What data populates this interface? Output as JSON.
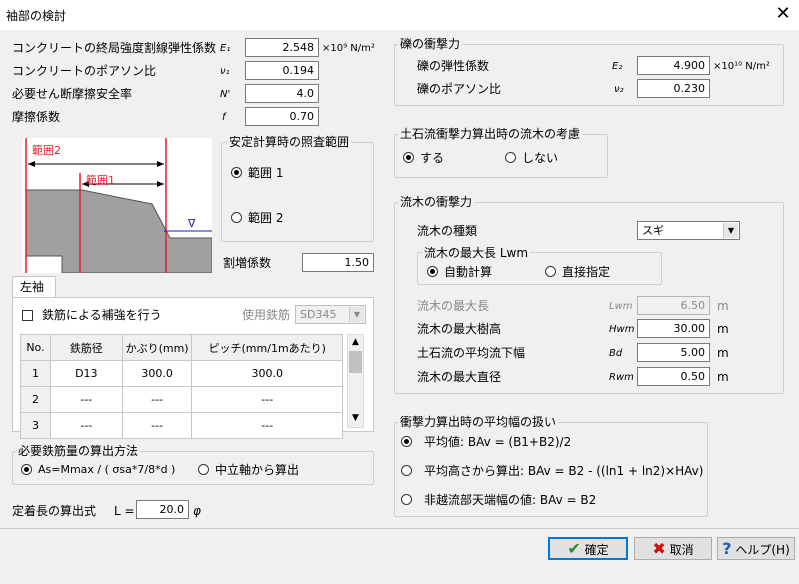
{
  "window": {
    "title": "袖部の検討",
    "close": "✕"
  },
  "left": {
    "fields": [
      {
        "label": "コンクリートの終局強度割線弾性係数",
        "symbol": "E₁",
        "value": "2.548",
        "unit": "×10⁹  N/m²"
      },
      {
        "label": "コンクリートのポアソン比",
        "symbol": "ν₁",
        "value": "0.194",
        "unit": ""
      },
      {
        "label": "必要せん断摩擦安全率",
        "symbol": "N'",
        "value": "4.0",
        "unit": ""
      },
      {
        "label": "摩擦係数",
        "symbol": "f",
        "value": "0.70",
        "unit": ""
      }
    ],
    "figure": {
      "range2": "範囲2",
      "range1": "範囲1",
      "water": "∇"
    },
    "range_group": {
      "title": "安定計算時の照査範囲",
      "options": [
        "範囲 1",
        "範囲 2"
      ],
      "selected": 0
    },
    "extra": {
      "label": "割増係数",
      "value": "1.50"
    },
    "tab": "左袖",
    "rebar": {
      "check_label": "鉄筋による補強を行う",
      "checked": false,
      "steel_label": "使用鉄筋",
      "steel_value": "SD345",
      "columns": [
        "No.",
        "鉄筋径",
        "かぶり(mm)",
        "ピッチ(mm/1mあたり)"
      ],
      "rows": [
        [
          "1",
          "D13",
          "300.0",
          "300.0"
        ],
        [
          "2",
          "---",
          "---",
          "---"
        ],
        [
          "3",
          "---",
          "---",
          "---"
        ]
      ]
    },
    "method": {
      "title": "必要鉄筋量の算出方法",
      "options": [
        "As=Mmax / ( σsa*7/8*d )",
        "中立軸から算出"
      ],
      "selected": 0
    },
    "anchor": {
      "label": "定着長の算出式",
      "prefix": "L =",
      "value": "20.0",
      "suffix": "φ"
    }
  },
  "right": {
    "gravel": {
      "title": "礫の衝撃力",
      "fields": [
        {
          "label": "礫の弾性係数",
          "symbol": "E₂",
          "value": "4.900",
          "unit": "×10¹⁰ N/m²"
        },
        {
          "label": "礫のポアソン比",
          "symbol": "ν₂",
          "value": "0.230",
          "unit": ""
        }
      ]
    },
    "debris": {
      "title": "土石流衝撃力算出時の流木の考慮",
      "options": [
        "する",
        "しない"
      ],
      "selected": 0
    },
    "wood": {
      "title": "流木の衝撃力",
      "type_label": "流木の種類",
      "type_value": "スギ",
      "maxlen_group": {
        "title": "流木の最大長  Lwm",
        "options": [
          "自動計算",
          "直接指定"
        ],
        "selected": 0
      },
      "fields": [
        {
          "label": "流木の最大長",
          "symbol": "Lwm",
          "value": "6.50",
          "unit": "m",
          "disabled": true
        },
        {
          "label": "流木の最大樹高",
          "symbol": "Hwm",
          "value": "30.00",
          "unit": "m",
          "disabled": false
        },
        {
          "label": "土石流の平均流下幅",
          "symbol": "Bd",
          "value": "5.00",
          "unit": "m",
          "disabled": false
        },
        {
          "label": "流木の最大直径",
          "symbol": "Rwm",
          "value": "0.50",
          "unit": "m",
          "disabled": false
        }
      ]
    },
    "width": {
      "title": "衝撃力算出時の平均幅の扱い",
      "options": [
        "平均値:  BAv = (B1+B2)/2",
        "平均高さから算出:  BAv = B2 - ((ln1 + ln2)×HAv)",
        "非越流部天端幅の値:  BAv = B2"
      ],
      "selected": 0
    }
  },
  "buttons": {
    "ok": "確定",
    "cancel": "取消",
    "help": "ヘルプ(H)"
  },
  "colors": {
    "range_line": "#e0202a",
    "fill": "#a0a0a0",
    "water": "#1a1aa0",
    "ok_icon": "#2a8a2a",
    "cancel_icon": "#cc1111",
    "help_icon": "#1a5fb4"
  }
}
